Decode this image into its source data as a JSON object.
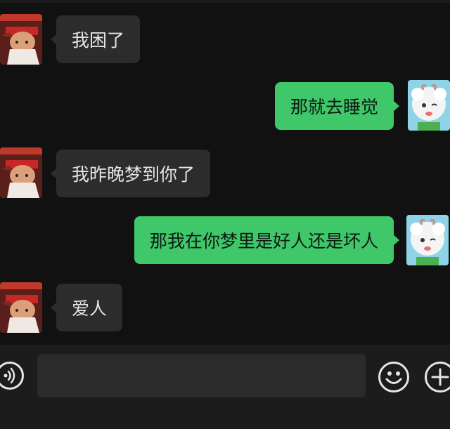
{
  "messages": [
    {
      "direction": "incoming",
      "text": "我困了"
    },
    {
      "direction": "outgoing",
      "text": "那就去睡觉"
    },
    {
      "direction": "incoming",
      "text": "我昨晚梦到你了"
    },
    {
      "direction": "outgoing",
      "text": "那我在你梦里是好人还是坏人"
    },
    {
      "direction": "incoming",
      "text": "爱人"
    }
  ],
  "input_bar": {
    "voice_icon": "voice-icon",
    "message_value": "",
    "emoji_icon": "emoji-icon",
    "more_icon": "plus-icon"
  },
  "colors": {
    "background": "#111111",
    "incoming_bubble": "#2c2c2c",
    "outgoing_bubble": "#3fc76a",
    "input_bar": "#1c1c1c"
  }
}
